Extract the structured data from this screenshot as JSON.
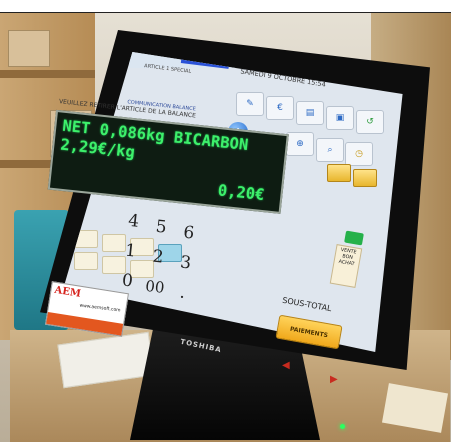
{
  "screen": {
    "date": "SAMEDI 9 OCTOBRE 15:54",
    "tabs": "ARTICLE 1   SPECIAL",
    "scale_dialog": {
      "title": "COMMUNICATION BALANCE",
      "instruction": "VEUILLEZ RETIRER L'ARTICLE DE LA BALANCE",
      "lcd_line1": "NET 0,086kg BICARBON",
      "lcd_line2": "2,29€/kg",
      "lcd_price": "0,20€"
    },
    "keypad": {
      "row1": [
        "4",
        "5",
        "6"
      ],
      "row2": [
        "1",
        "2",
        "3"
      ],
      "row3": [
        "0",
        "00",
        "."
      ]
    },
    "buttons": {
      "sous_total": "SOUS-TOTAL",
      "paiements": "PAIEMENTS",
      "vente_bon_achat": "VENTE BON ACHAT",
      "rendu": "RENDU"
    }
  },
  "monitor_brand": "TOSHIBA",
  "sticker": {
    "logo": "AEM",
    "url": "www.aemsoft.com"
  }
}
